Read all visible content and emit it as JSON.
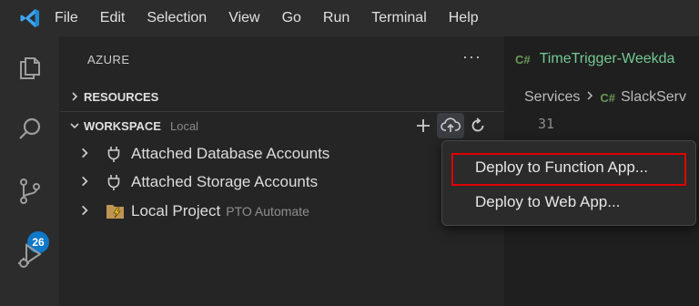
{
  "menu": {
    "logo": "vscode-logo-icon",
    "items": [
      "File",
      "Edit",
      "Selection",
      "View",
      "Go",
      "Run",
      "Terminal",
      "Help"
    ]
  },
  "activity": {
    "icons": [
      "explorer-icon",
      "search-icon",
      "source-control-icon",
      "run-debug-icon"
    ],
    "source_control_badge": "26"
  },
  "sidebar": {
    "title": "AZURE",
    "more": "···",
    "resources": {
      "label": "RESOURCES"
    },
    "workspace": {
      "label": "WORKSPACE",
      "desc": "Local",
      "actions": [
        "add-icon",
        "deploy-cloud-icon",
        "refresh-icon"
      ],
      "items": [
        {
          "label": "Attached Database Accounts",
          "sub": ""
        },
        {
          "label": "Attached Storage Accounts",
          "sub": ""
        },
        {
          "label": "Local Project",
          "sub": "PTO Automate"
        }
      ]
    }
  },
  "editor": {
    "tab": {
      "lang": "C#",
      "name": "TimeTrigger-Weekda"
    },
    "breadcrumb": {
      "folder": "Services",
      "lang": "C#",
      "file": "SlackServ"
    },
    "line_number": "31"
  },
  "context_menu": {
    "items": [
      "Deploy to Function App...",
      "Deploy to Web App..."
    ]
  },
  "colors": {
    "accent": "#0e78c9",
    "highlight_border": "#e00000",
    "tab_text": "#73c991"
  }
}
